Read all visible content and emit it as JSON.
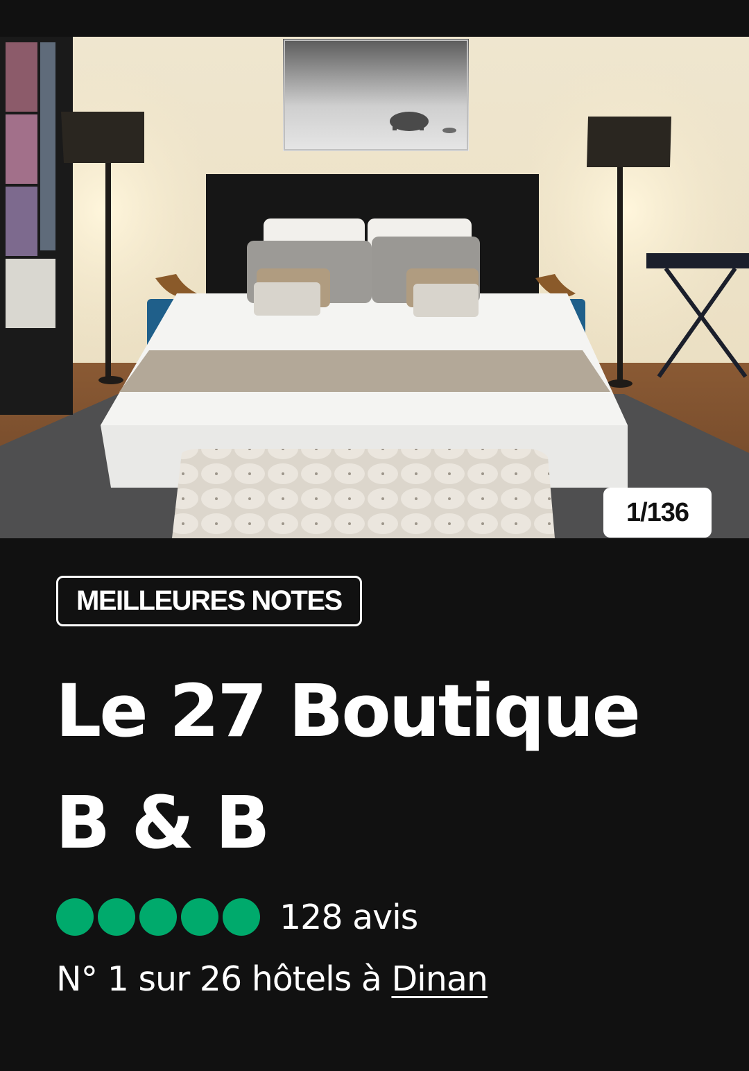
{
  "photo": {
    "counter": "1/136",
    "description_icon": "bedroom-photo"
  },
  "badge": {
    "label": "MEILLEURES NOTES"
  },
  "hotel": {
    "name": "Le 27 Boutique B & B"
  },
  "rating": {
    "bubbles_filled": 5,
    "bubbles_total": 5,
    "bubble_color": "#00aa6c",
    "review_count": "128 avis"
  },
  "ranking": {
    "prefix": "N° 1 sur 26 hôtels à",
    "city_link": "Dinan"
  },
  "colors": {
    "background": "#111111",
    "text": "#ffffff",
    "accent": "#00aa6c"
  }
}
